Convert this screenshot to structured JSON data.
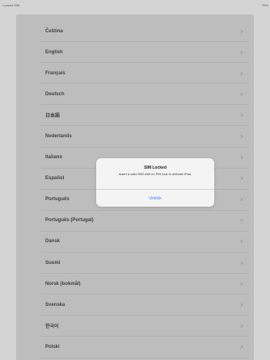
{
  "status_bar": {
    "carrier": "Locked SIM",
    "battery": "76%"
  },
  "language_list": {
    "items": [
      {
        "label": "Čeština"
      },
      {
        "label": "English"
      },
      {
        "label": "Français"
      },
      {
        "label": "Deutsch"
      },
      {
        "label": "日本語"
      },
      {
        "label": "Nederlands"
      },
      {
        "label": "Italiano"
      },
      {
        "label": "Español"
      },
      {
        "label": "Português"
      },
      {
        "label": "Português (Portugal)"
      },
      {
        "label": "Dansk"
      },
      {
        "label": "Suomi"
      },
      {
        "label": "Norsk (bokmål)"
      },
      {
        "label": "Svenska"
      },
      {
        "label": "한국어"
      },
      {
        "label": "Polski"
      }
    ]
  },
  "alert": {
    "title": "SIM Locked",
    "message": "Insert a valid SIM with no PIN lock to activate iPad.",
    "button_label": "Unlock"
  }
}
